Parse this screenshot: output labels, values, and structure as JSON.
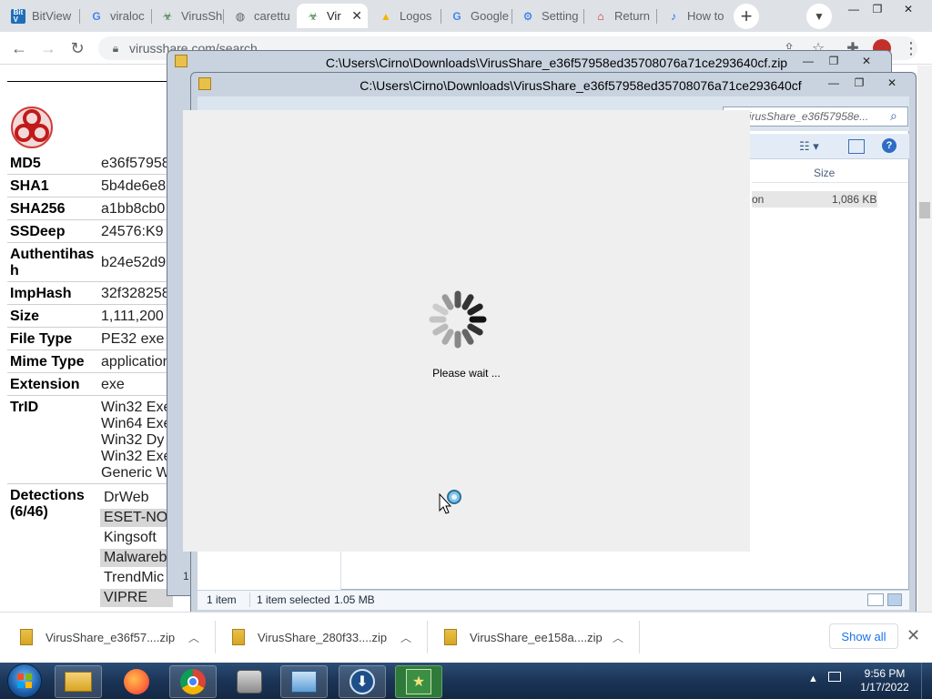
{
  "browser": {
    "tabs": [
      {
        "label": "BitView",
        "favicon": "bitview-icon"
      },
      {
        "label": "viraloc",
        "favicon": "google-g-icon"
      },
      {
        "label": "VirusSh",
        "favicon": "virusshare-icon"
      },
      {
        "label": "carettu",
        "favicon": "globe-icon"
      },
      {
        "label": "Vir",
        "favicon": "virusshare-icon",
        "active": true
      },
      {
        "label": "Logos",
        "favicon": "google-drive-icon"
      },
      {
        "label": "Google",
        "favicon": "google-g-icon"
      },
      {
        "label": "Setting",
        "favicon": "gear-icon"
      },
      {
        "label": "Return",
        "favicon": "return-icon"
      },
      {
        "label": "How to",
        "favicon": "link-icon"
      }
    ],
    "url": "virusshare.com/search"
  },
  "file_info": {
    "rows": [
      {
        "key": "MD5",
        "value": "e36f57958"
      },
      {
        "key": "SHA1",
        "value": "5b4de6e8"
      },
      {
        "key": "SHA256",
        "value": "a1bb8cb0"
      },
      {
        "key": "SSDeep",
        "value": "24576:K9"
      },
      {
        "key": "Authentihash",
        "value": "b24e52d9"
      },
      {
        "key": "ImpHash",
        "value": "32f328258"
      },
      {
        "key": "Size",
        "value": "1,111,200"
      },
      {
        "key": "File Type",
        "value": "PE32 exe"
      },
      {
        "key": "Mime Type",
        "value": "application"
      },
      {
        "key": "Extension",
        "value": "exe"
      }
    ],
    "trid_label": "TrID",
    "trid": [
      "Win32 Exe",
      "Win64 Exe",
      "Win32 Dy",
      "Win32 Exe",
      "Generic W"
    ],
    "detections_label": "Detections (6/46)",
    "detections": [
      "DrWeb",
      "ESET-NO",
      "Kingsoft",
      "Malwareb",
      "TrendMic",
      "VIPRE"
    ]
  },
  "explorer_back": {
    "title": "C:\\Users\\Cirno\\Downloads\\VirusShare_e36f57958ed35708076a71ce293640cf.zip"
  },
  "explorer_front": {
    "title": "C:\\Users\\Cirno\\Downloads\\VirusShare_e36f57958ed35708076a71ce293640cf",
    "search_placeholder": "ch VirusShare_e36f57958e...",
    "col_size": "Size",
    "row_type": "on",
    "row_size": "1,086 KB",
    "status_items": "1 item",
    "status_selected": "1 item selected",
    "status_size": "1.05 MB",
    "navpane_count": "1"
  },
  "dialog": {
    "message": "Please wait ..."
  },
  "downloads": [
    {
      "name": "VirusShare_e36f57....zip"
    },
    {
      "name": "VirusShare_280f33....zip"
    },
    {
      "name": "VirusShare_ee158a....zip"
    }
  ],
  "downloads_show_all": "Show all",
  "taskbar": {
    "time": "9:56 PM",
    "date": "1/17/2022"
  },
  "colors": {
    "chrome_tabstrip": "#dee1e6",
    "taskbar": "#1b3456",
    "explorer_frame": "#c9d3df",
    "link_blue": "#1a73e8"
  }
}
